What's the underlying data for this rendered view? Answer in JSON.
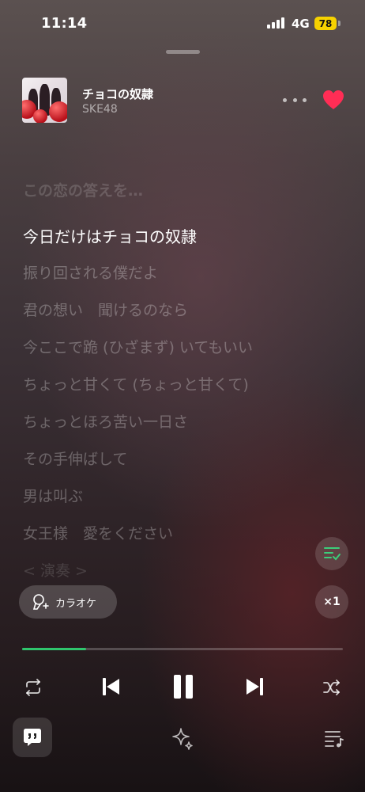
{
  "status_bar": {
    "time": "11:14",
    "network": "4G",
    "battery": "78"
  },
  "now_playing": {
    "title": "チョコの奴隷",
    "artist": "SKE48",
    "liked": true
  },
  "lyrics": [
    {
      "text": "この恋の答えを…",
      "state": "past"
    },
    {
      "text": "今日だけはチョコの奴隷",
      "state": "current"
    },
    {
      "text": "振り回される僕だよ",
      "state": "upcoming"
    },
    {
      "text": "君の想い　聞けるのなら",
      "state": "upcoming"
    },
    {
      "text": "今ここで跪 (ひざまず) いてもいい",
      "state": "upcoming"
    },
    {
      "text": "ちょっと甘くて (ちょっと甘くて)",
      "state": "upcoming"
    },
    {
      "text": "ちょっとほろ苦い一日さ",
      "state": "upcoming"
    },
    {
      "text": "その手伸ばして",
      "state": "upcoming"
    },
    {
      "text": "男は叫ぶ",
      "state": "upcoming"
    },
    {
      "text": "女王様　愛をください",
      "state": "upcoming"
    },
    {
      "text": "< 演奏 >",
      "state": "fade"
    }
  ],
  "controls": {
    "karaoke_label": "カラオケ",
    "speed_label": "×1"
  },
  "playback": {
    "progress": 0.2
  },
  "colors": {
    "accent": "#2fc56d",
    "like": "#ff2d55",
    "battery": "#f6d200"
  },
  "icons": [
    "repeat-icon",
    "previous-icon",
    "pause-icon",
    "next-icon",
    "shuffle-icon",
    "lyrics-share-icon",
    "sparkle-icon",
    "queue-icon",
    "microphone-icon",
    "lyrics-sync-icon",
    "heart-icon",
    "more-icon"
  ]
}
